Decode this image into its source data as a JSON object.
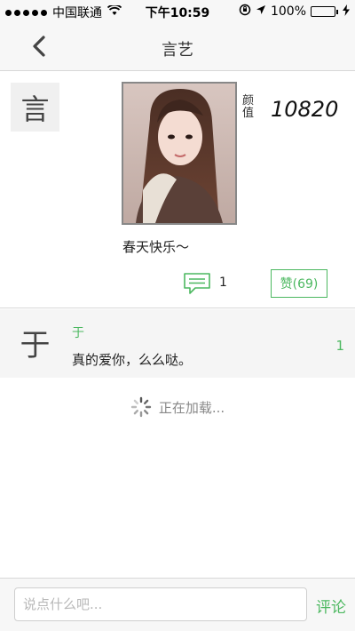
{
  "status_bar": {
    "carrier": "中国联通",
    "time": "下午10:59",
    "battery_text": "100%",
    "battery_level": 1.0,
    "icons": [
      "signal-dots-icon",
      "wifi-icon",
      "rotation-lock-icon",
      "location-arrow-icon",
      "battery-icon",
      "charging-bolt-icon"
    ]
  },
  "nav": {
    "title": "言艺",
    "back_icon": "chevron-left-icon"
  },
  "post": {
    "author_avatar_char": "言",
    "photo_icon": "portrait-photo",
    "vote_label": "颜值",
    "score": "10820",
    "caption": "春天快乐～",
    "comment_icon": "speech-bubble-icon",
    "comment_count": "1",
    "like_label": "赞(69)"
  },
  "comments": [
    {
      "avatar_char": "于",
      "name": "于",
      "text": "真的爱你，么么哒。",
      "count": "1"
    }
  ],
  "loading_text": "正在加载...",
  "input": {
    "placeholder": "说点什么吧...",
    "send_label": "评论"
  },
  "colors": {
    "accent": "#4cb860",
    "bar_bg": "#f7f7f7",
    "comment_bg": "#f5f5f5"
  }
}
